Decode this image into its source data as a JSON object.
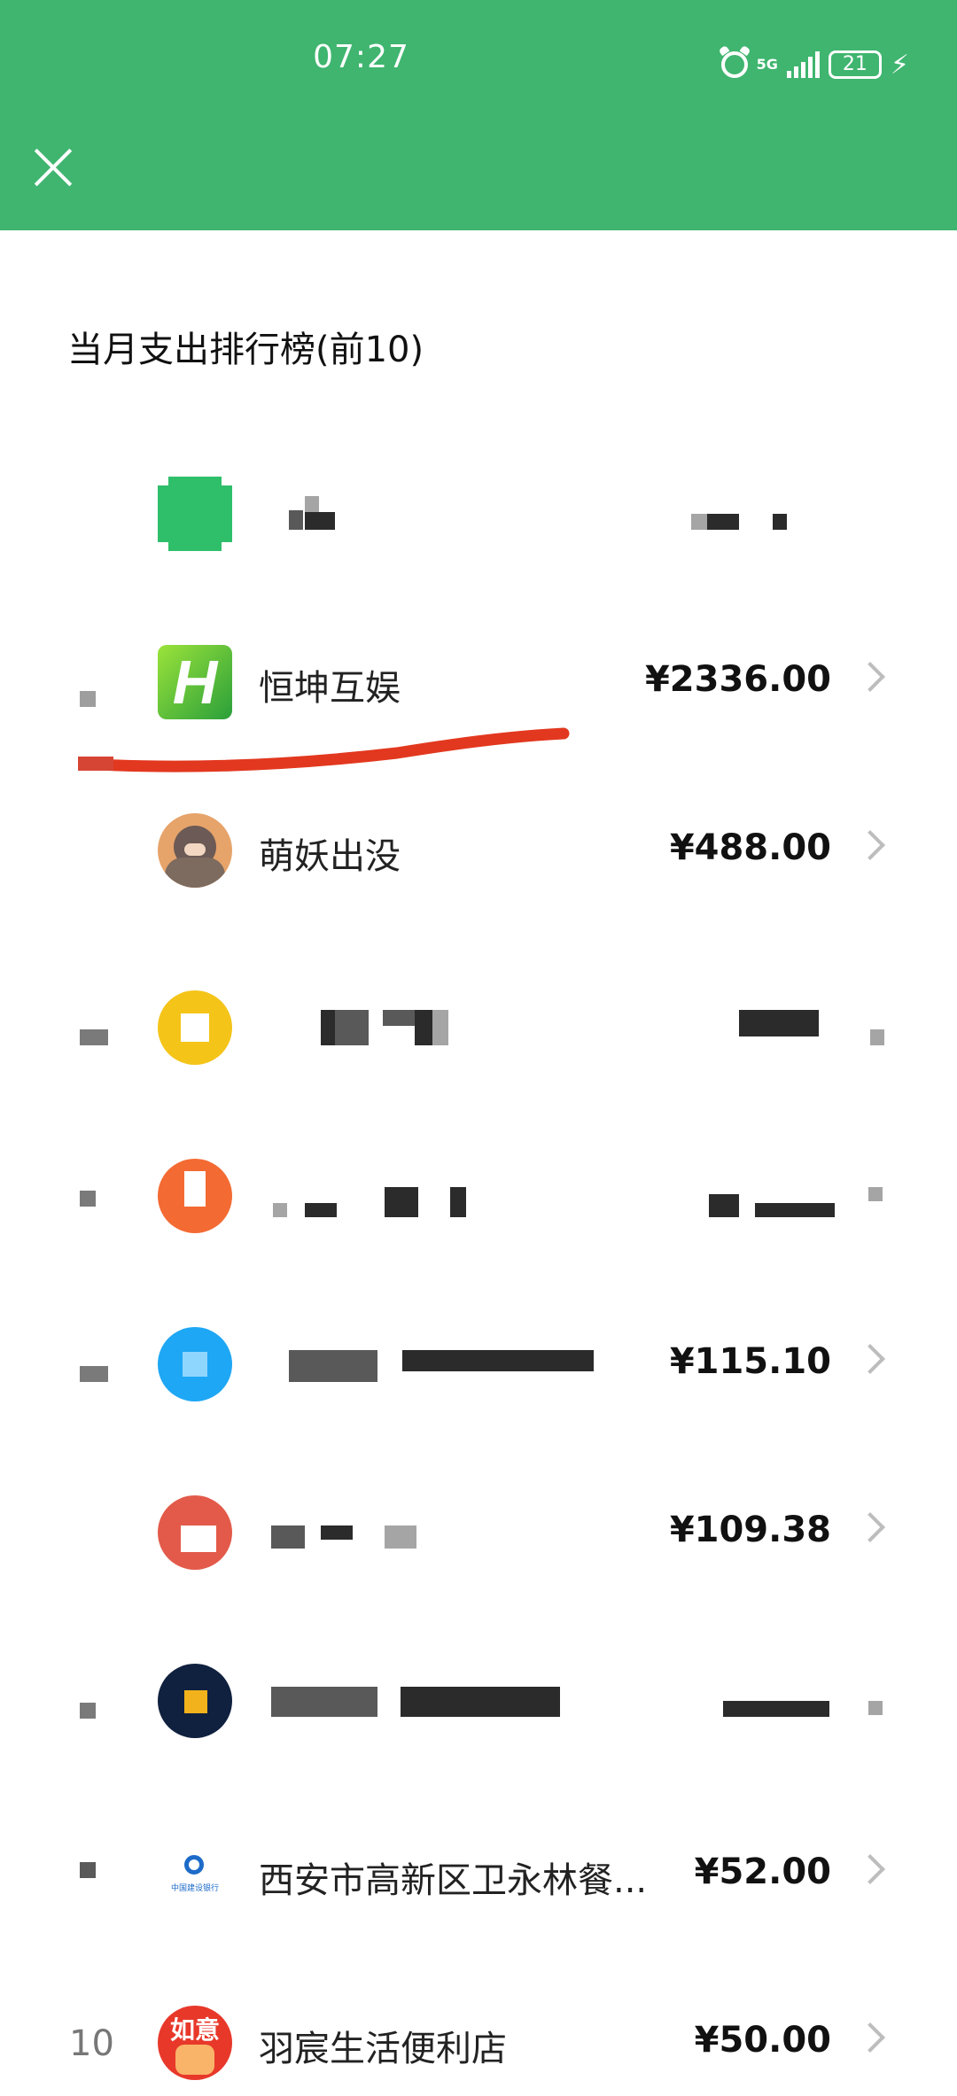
{
  "status_bar": {
    "time": "07:27",
    "network": "5G",
    "battery": "21"
  },
  "list_title": "当月支出排行榜(前10)",
  "items": [
    {
      "rank": "",
      "name": "",
      "amount": ""
    },
    {
      "rank": "",
      "name": "恒坤互娱",
      "amount": "¥2336.00"
    },
    {
      "rank": "",
      "name": "萌妖出没",
      "amount": "¥488.00"
    },
    {
      "rank": "",
      "name": "",
      "amount": ""
    },
    {
      "rank": "",
      "name": "",
      "amount": ""
    },
    {
      "rank": "",
      "name": "",
      "amount": "¥115.10"
    },
    {
      "rank": "",
      "name": "",
      "amount": "¥109.38"
    },
    {
      "rank": "",
      "name": "",
      "amount": ""
    },
    {
      "rank": "",
      "name": "西安市高新区卫永林餐...",
      "amount": "¥52.00"
    },
    {
      "rank": "10",
      "name": "羽宸生活便利店",
      "amount": "¥50.00"
    }
  ],
  "avatar_labels": {
    "bank_small_text": "中国建设银行",
    "ruyi_text": "如意"
  },
  "colors": {
    "header": "#3fb56f",
    "annotation_stroke": "#e2381f"
  }
}
